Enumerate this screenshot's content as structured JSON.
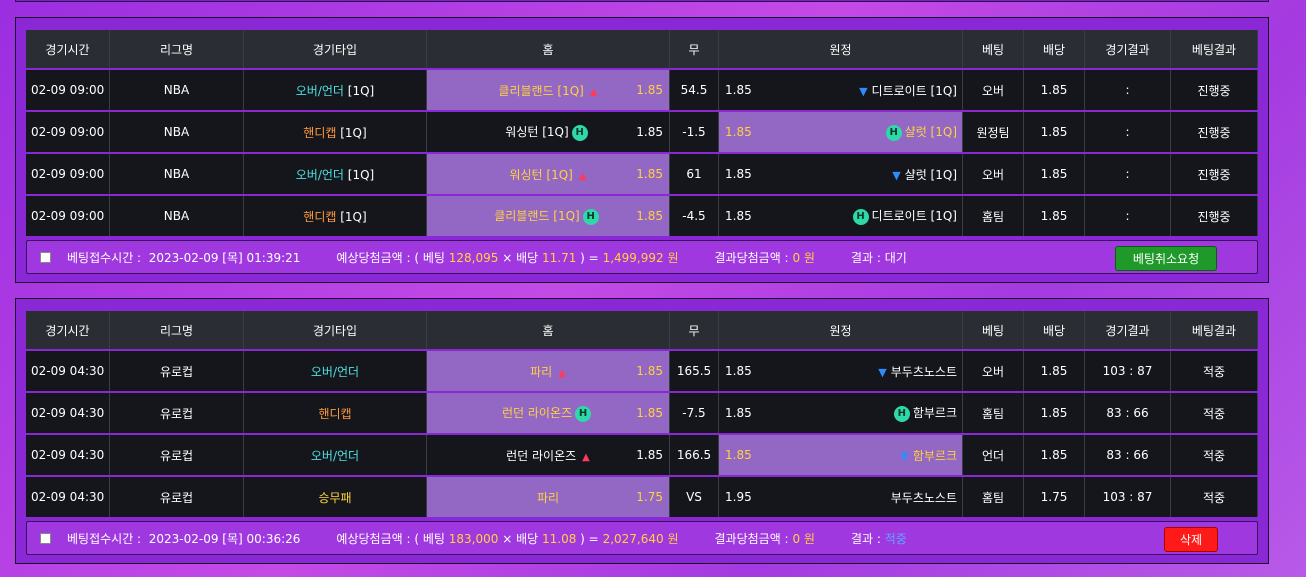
{
  "headers": [
    "경기시간",
    "리그명",
    "경기타입",
    "홈",
    "무",
    "원정",
    "베팅",
    "배당",
    "경기결과",
    "베팅결과"
  ],
  "slips": [
    {
      "rows": [
        {
          "time": "02-09 09:00",
          "league": "NBA",
          "type": "오버/언더",
          "type_suffix": " [1Q]",
          "type_color": "cyan",
          "home": "클리블랜드 [1Q]",
          "home_mark": "up",
          "home_odds": "1.85",
          "home_hl": true,
          "draw": "54.5",
          "away": "디트로이트 [1Q]",
          "away_mark": "down",
          "away_odds": "1.85",
          "away_hl": false,
          "pick": "오버",
          "odds": "1.85",
          "score": ":",
          "result": "진행중"
        },
        {
          "time": "02-09 09:00",
          "league": "NBA",
          "type": "핸디캡",
          "type_suffix": " [1Q]",
          "type_color": "orange",
          "home": "워싱턴 [1Q]",
          "home_mark": "H",
          "home_odds": "1.85",
          "home_hl": false,
          "draw": "-1.5",
          "away": "샬럿 [1Q]",
          "away_mark": "H",
          "away_odds": "1.85",
          "away_hl": true,
          "pick": "원정팀",
          "odds": "1.85",
          "score": ":",
          "result": "진행중"
        },
        {
          "time": "02-09 09:00",
          "league": "NBA",
          "type": "오버/언더",
          "type_suffix": " [1Q]",
          "type_color": "cyan",
          "home": "워싱턴 [1Q]",
          "home_mark": "up",
          "home_odds": "1.85",
          "home_hl": true,
          "draw": "61",
          "away": "샬럿 [1Q]",
          "away_mark": "down",
          "away_odds": "1.85",
          "away_hl": false,
          "pick": "오버",
          "odds": "1.85",
          "score": ":",
          "result": "진행중"
        },
        {
          "time": "02-09 09:00",
          "league": "NBA",
          "type": "핸디캡",
          "type_suffix": " [1Q]",
          "type_color": "orange",
          "home": "클리블랜드 [1Q]",
          "home_mark": "H",
          "home_odds": "1.85",
          "home_hl": true,
          "draw": "-4.5",
          "away": "디트로이트 [1Q]",
          "away_mark": "H",
          "away_odds": "1.85",
          "away_hl": false,
          "pick": "홈팀",
          "odds": "1.85",
          "score": ":",
          "result": "진행중"
        }
      ],
      "summary": {
        "time_label": "베팅접수시간 :",
        "time_value": "2023-02-09 [목] 01:39:21",
        "expected_label": "예상당첨금액 : ( 베팅",
        "bet_amount": "128,095",
        "times": "× 배당",
        "total_odds": "11.71",
        "equals": ") =",
        "expected_amount": "1,499,992 원",
        "win_label": "결과당첨금액 :",
        "win_amount": "0 원",
        "result_label": "결과 :",
        "result_value": "대기",
        "button": "베팅취소요청"
      }
    },
    {
      "rows": [
        {
          "time": "02-09 04:30",
          "league": "유로컵",
          "type": "오버/언더",
          "type_suffix": "",
          "type_color": "cyan",
          "home": "파리",
          "home_mark": "up",
          "home_odds": "1.85",
          "home_hl": true,
          "draw": "165.5",
          "away": "부두츠노스트",
          "away_mark": "down",
          "away_odds": "1.85",
          "away_hl": false,
          "pick": "오버",
          "odds": "1.85",
          "score": "103 : 87",
          "result": "적중"
        },
        {
          "time": "02-09 04:30",
          "league": "유로컵",
          "type": "핸디캡",
          "type_suffix": "",
          "type_color": "orange",
          "home": "런던 라이온즈",
          "home_mark": "H",
          "home_odds": "1.85",
          "home_hl": true,
          "draw": "-7.5",
          "away": "함부르크",
          "away_mark": "H",
          "away_odds": "1.85",
          "away_hl": false,
          "pick": "홈팀",
          "odds": "1.85",
          "score": "83 : 66",
          "result": "적중"
        },
        {
          "time": "02-09 04:30",
          "league": "유로컵",
          "type": "오버/언더",
          "type_suffix": "",
          "type_color": "cyan",
          "home": "런던 라이온즈",
          "home_mark": "up",
          "home_odds": "1.85",
          "home_hl": false,
          "draw": "166.5",
          "away": "함부르크",
          "away_mark": "down",
          "away_odds": "1.85",
          "away_hl": true,
          "pick": "언더",
          "odds": "1.85",
          "score": "83 : 66",
          "result": "적중"
        },
        {
          "time": "02-09 04:30",
          "league": "유로컵",
          "type": "승무패",
          "type_suffix": "",
          "type_color": "yellow",
          "home": "파리",
          "home_mark": "",
          "home_odds": "1.75",
          "home_hl": true,
          "draw": "VS",
          "away": "부두츠노스트",
          "away_mark": "",
          "away_odds": "1.95",
          "away_hl": false,
          "pick": "홈팀",
          "odds": "1.75",
          "score": "103 : 87",
          "result": "적중"
        }
      ],
      "summary": {
        "time_label": "베팅접수시간 :",
        "time_value": "2023-02-09 [목] 00:36:26",
        "expected_label": "예상당첨금액 : ( 베팅",
        "bet_amount": "183,000",
        "times": "× 배당",
        "total_odds": "11.08",
        "equals": ") =",
        "expected_amount": "2,027,640 원",
        "win_label": "결과당첨금액 :",
        "win_amount": "0 원",
        "result_label": "결과 :",
        "result_value": "적중",
        "button": "삭제"
      }
    }
  ]
}
